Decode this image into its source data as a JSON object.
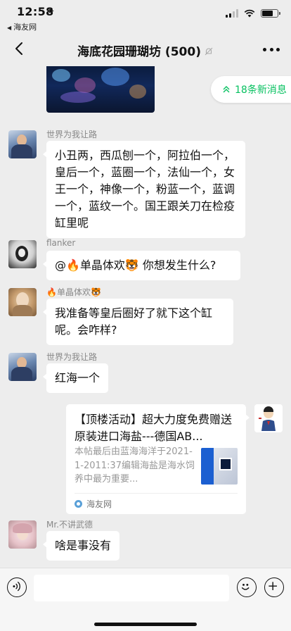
{
  "status_bar": {
    "time": "12:58",
    "back_app": "海友网"
  },
  "nav": {
    "title": "海底花园珊瑚坊 (500)"
  },
  "new_messages": {
    "label": "18条新消息"
  },
  "messages": [
    {
      "sender": "世界为我让路",
      "text": "小丑两，西瓜刨一个，阿拉伯一个，皇后一个，蓝圈一个，法仙一个，女王一个，神像一个，粉蓝一个，蓝调一个，蓝纹一个。国王跟关刀在检疫缸里呢"
    },
    {
      "sender": "flanker",
      "text": "@🔥单晶体欢🐯 你想发生什么?"
    },
    {
      "sender": "🔥单晶体欢🐯",
      "text": "我准备等皇后圈好了就下这个缸呢。会咋样?"
    },
    {
      "sender": "世界为我让路",
      "text": "红海一个"
    },
    {
      "sender": "Mr.不讲武德",
      "text": "啥是事没有"
    }
  ],
  "card": {
    "title": "【顶楼活动】超大力度免费赠送原装进口海盐---德国AB...",
    "description": "本帖最后由蓝海海洋于2021-1-2011:37编辑海盐是海水饲养中最为重要...",
    "source": "海友网"
  },
  "input_bar": {
    "placeholder": ""
  }
}
